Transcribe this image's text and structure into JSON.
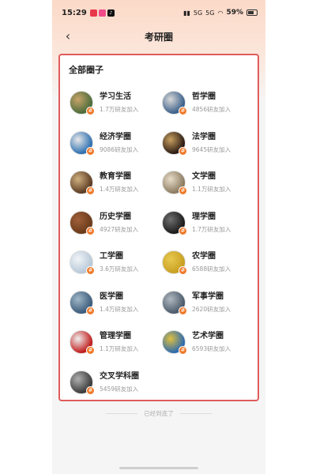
{
  "status_bar": {
    "time": "15:29",
    "apps": [
      {
        "name": "app-icon-red",
        "color": "#e8394a"
      },
      {
        "name": "app-icon-pink",
        "color": "#f04a8a"
      },
      {
        "name": "tiktok-icon",
        "color": "#111111"
      }
    ],
    "network_1": "5G",
    "network_2": "5G",
    "battery": "59%"
  },
  "nav": {
    "back_icon": "‹",
    "title": "考研圈"
  },
  "card": {
    "title": "全部圈子",
    "border_color": "#e05c5c",
    "circles": [
      {
        "name": "学习生活",
        "members": "1.7万研友加入",
        "avatar_colors": [
          "#4a6b3a",
          "#c9a46a"
        ]
      },
      {
        "name": "哲学圈",
        "members": "4856研友加入",
        "avatar_colors": [
          "#3a5f8a",
          "#d8d8d8"
        ]
      },
      {
        "name": "经济学圈",
        "members": "9086研友加入",
        "avatar_colors": [
          "#2b6fb0",
          "#e8e8e8"
        ]
      },
      {
        "name": "法学圈",
        "members": "9645研友加入",
        "avatar_colors": [
          "#2a1a12",
          "#c8a060"
        ]
      },
      {
        "name": "教育学圈",
        "members": "1.4万研友加入",
        "avatar_colors": [
          "#5a3a22",
          "#d0b080"
        ]
      },
      {
        "name": "文学圈",
        "members": "1.1万研友加入",
        "avatar_colors": [
          "#8a7a60",
          "#e8dcc8"
        ]
      },
      {
        "name": "历史学圈",
        "members": "4927研友加入",
        "avatar_colors": [
          "#6a3a1a",
          "#a0603a"
        ]
      },
      {
        "name": "理学圈",
        "members": "1.7万研友加入",
        "avatar_colors": [
          "#1a1a1a",
          "#707070"
        ]
      },
      {
        "name": "工学圈",
        "members": "3.6万研友加入",
        "avatar_colors": [
          "#b8c8d8",
          "#f0f4f8"
        ]
      },
      {
        "name": "农学圈",
        "members": "6588研友加入",
        "avatar_colors": [
          "#c8a020",
          "#e8c850"
        ]
      },
      {
        "name": "医学圈",
        "members": "1.4万研友加入",
        "avatar_colors": [
          "#3a5a7a",
          "#a0b8c8"
        ]
      },
      {
        "name": "军事学圈",
        "members": "2620研友加入",
        "avatar_colors": [
          "#4a5a6a",
          "#b0b8c0"
        ]
      },
      {
        "name": "管理学圈",
        "members": "1.1万研友加入",
        "avatar_colors": [
          "#c01a1a",
          "#f0f0f0"
        ]
      },
      {
        "name": "艺术学圈",
        "members": "6593研友加入",
        "avatar_colors": [
          "#2a6ab0",
          "#e0c040"
        ]
      },
      {
        "name": "交叉学科圈",
        "members": "5459研友加入",
        "avatar_colors": [
          "#3a3a3a",
          "#b0b0b0"
        ]
      }
    ]
  },
  "end_text": "已经到底了",
  "badge_color": "#f07a2a"
}
